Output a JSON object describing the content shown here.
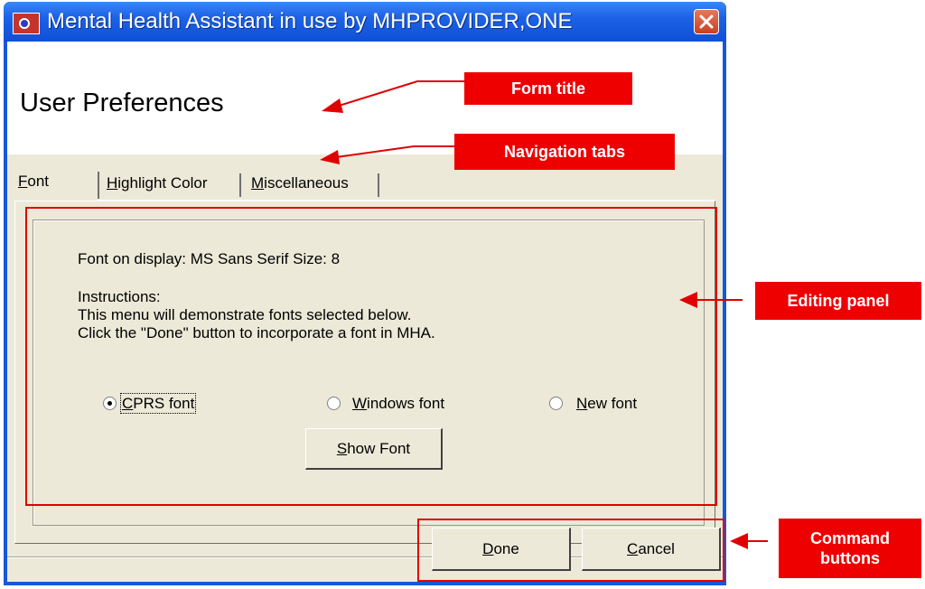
{
  "window": {
    "title": "Mental Health Assistant in use by MHPROVIDER,ONE",
    "app_icon": "mha-app-icon",
    "close_icon": "close-icon"
  },
  "form": {
    "title": "User Preferences"
  },
  "tabs": [
    {
      "label": "Font",
      "mnemonic": "F",
      "rest": "ont",
      "selected": true
    },
    {
      "label": "Highlight Color",
      "mnemonic": "H",
      "rest": "ighlight Color",
      "selected": false
    },
    {
      "label": "Miscellaneous",
      "mnemonic": "M",
      "rest": "iscellaneous",
      "selected": false
    }
  ],
  "panel": {
    "font_on_display": "Font on display: MS Sans Serif   Size: 8",
    "instructions_heading": "Instructions:",
    "instructions_line1": "This menu will demonstrate fonts selected below.",
    "instructions_line2": "Click the \"Done\" button to incorporate a font in MHA.",
    "options": [
      {
        "label": "CPRS font",
        "mnemonic": "C",
        "rest": "PRS font",
        "selected": true
      },
      {
        "label": "Windows font",
        "mnemonic": "W",
        "rest": "indows font",
        "selected": false
      },
      {
        "label": "New font",
        "mnemonic": "N",
        "rest": "ew font",
        "selected": false
      }
    ],
    "show_font_button": {
      "mnemonic": "S",
      "rest": "how Font"
    }
  },
  "commands": {
    "done": {
      "mnemonic": "D",
      "rest": "one"
    },
    "cancel": {
      "mnemonic": "C",
      "rest": "ancel"
    }
  },
  "annotations": {
    "form_title": "Form title",
    "navigation_tabs": "Navigation tabs",
    "editing_panel": "Editing panel",
    "command_buttons_line1": "Command",
    "command_buttons_line2": "buttons",
    "color": "#ee0000"
  }
}
